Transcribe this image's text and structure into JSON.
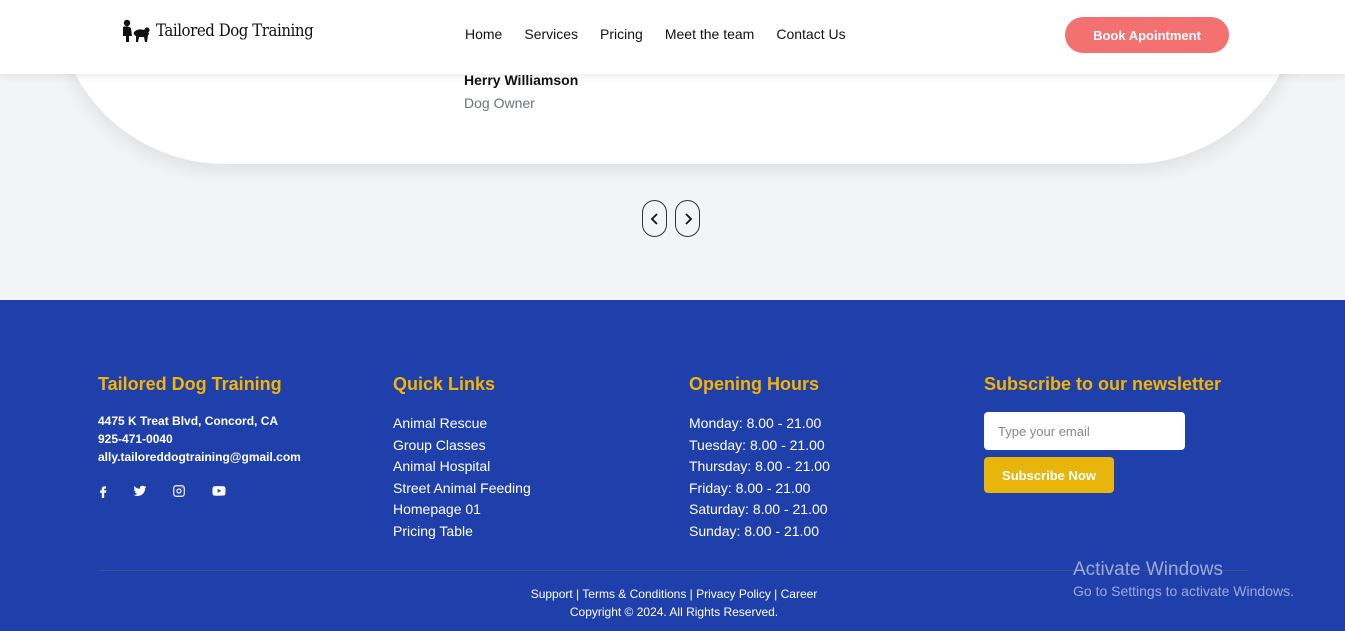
{
  "header": {
    "logo_text": "Tailored Dog Training",
    "nav": [
      "Home",
      "Services",
      "Pricing",
      "Meet the team",
      "Contact Us"
    ],
    "book_button": "Book Apointment"
  },
  "testimonial": {
    "name": "Herry Williamson",
    "role": "Dog Owner"
  },
  "footer": {
    "company": {
      "title": "Tailored Dog Training",
      "address": "4475 K Treat Blvd, Concord, CA",
      "phone": "925-471-0040",
      "email": "ally.tailoreddogtraining@gmail.com",
      "social_icons": [
        "facebook-icon",
        "twitter-icon",
        "instagram-icon",
        "youtube-icon"
      ]
    },
    "quick_links": {
      "title": "Quick Links",
      "items": [
        "Animal Rescue",
        "Group Classes",
        "Animal Hospital",
        "Street Animal Feeding",
        "Homepage 01",
        "Pricing Table"
      ]
    },
    "opening_hours": {
      "title": "Opening Hours",
      "items": [
        "Monday: 8.00 - 21.00",
        "Tuesday: 8.00 - 21.00",
        "Thursday: 8.00 - 21.00",
        "Friday: 8.00 - 21.00",
        "Saturday: 8.00 - 21.00",
        "Sunday: 8.00 - 21.00"
      ]
    },
    "newsletter": {
      "title": "Subscribe to our newsletter",
      "placeholder": "Type your email",
      "button": "Subscribe Now"
    },
    "bottom": {
      "links": [
        "Support",
        "Terms & Conditions",
        "Privacy Policy",
        "Career"
      ],
      "separator": " | ",
      "copyright": "Copyright © 2024. All Rights Reserved."
    }
  },
  "watermark": {
    "line1": "Activate Windows",
    "line2": "Go to Settings to activate Windows."
  },
  "colors": {
    "accent_button": "#f47171",
    "footer_bg": "#1f3fab",
    "heading_yellow": "#f4b400",
    "subscribe_button": "#e7b50b"
  }
}
